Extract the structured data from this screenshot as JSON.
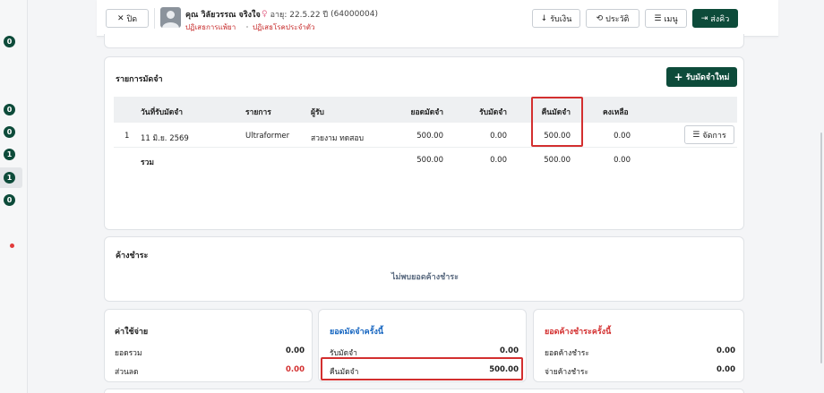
{
  "rail": {
    "badges": [
      "0",
      "0",
      "0",
      "1",
      "1",
      "0"
    ]
  },
  "header": {
    "close_label": "ปิด",
    "patient_name": "คุณ วิลัยวรรณ จริงใจ",
    "gender_icon": "female-icon",
    "age": "อายุ: 22.5.22 ปี",
    "hn": "(64000004)",
    "drug_allergy": "ปฏิเสธการแพ้ยา",
    "chronic_disease": "ปฏิเสธโรคประจำตัว",
    "buttons": {
      "receive_money": "รับเงิน",
      "history": "ประวัติ",
      "menu": "เมนู",
      "send_queue": "ส่งคิว"
    }
  },
  "deposits": {
    "title": "รายการมัดจำ",
    "new_button": "รับมัดจำใหม่",
    "columns": [
      "วันที่รับมัดจำ",
      "รายการ",
      "ผู้รับ",
      "ยอดมัดจำ",
      "รับมัดจำ",
      "คืนมัดจำ",
      "คงเหลือ"
    ],
    "rows": [
      {
        "no": "1",
        "date": "11 มิ.ย. 2569",
        "item": "Ultraformer",
        "receiver": "สวยงาม ทดสอบ",
        "amount": "500.00",
        "received": "0.00",
        "refunded": "500.00",
        "balance": "0.00",
        "action": "จัดการ"
      }
    ],
    "total": {
      "label": "รวม",
      "amount": "500.00",
      "received": "0.00",
      "refunded": "500.00",
      "balance": "0.00"
    }
  },
  "outstanding": {
    "title": "ค้างชำระ",
    "empty": "ไม่พบยอดค้างชำระ"
  },
  "expenses": {
    "title": "ค่าใช้จ่าย",
    "total_label": "ยอดรวม",
    "total_value": "0.00",
    "discount_label": "ส่วนลด",
    "discount_value": "0.00"
  },
  "deposit_now": {
    "title": "ยอดมัดจำครั้งนี้",
    "receive_label": "รับมัดจำ",
    "receive_value": "0.00",
    "refund_label": "คืนมัดจำ",
    "refund_value": "500.00"
  },
  "outstanding_now": {
    "title": "ยอดค้างชำระครั้งนี้",
    "outstanding_label": "ยอดค้างชำระ",
    "outstanding_value": "0.00",
    "pay_label": "จ่ายค้างชำระ",
    "pay_value": "0.00"
  },
  "colors": {
    "accent": "#0d4b3a",
    "danger": "#d32f2f",
    "link": "#1565c0"
  }
}
